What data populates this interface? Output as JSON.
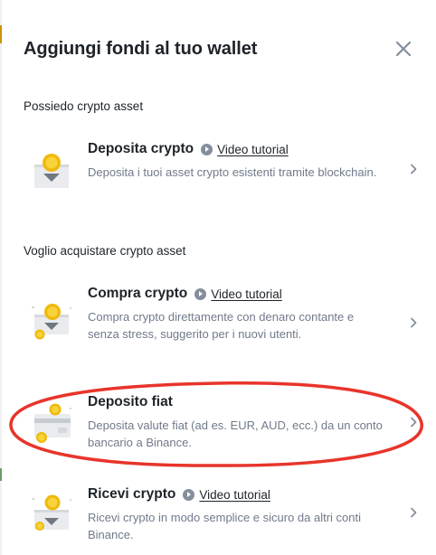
{
  "modal": {
    "title": "Aggiungi fondi al tuo wallet",
    "close_icon": "close-icon"
  },
  "sections": [
    {
      "label": "Possiedo crypto asset",
      "items": [
        {
          "name": "Deposita crypto",
          "tutorial": "Video tutorial",
          "description": "Deposita i tuoi asset crypto esistenti tramite blockchain.",
          "icon": "crypto-deposit-icon"
        }
      ]
    },
    {
      "label": "Voglio acquistare crypto asset",
      "items": [
        {
          "name": "Compra crypto",
          "tutorial": "Video tutorial",
          "description": "Compra crypto direttamente con denaro contante e senza stress, suggerito per i nuovi utenti.",
          "icon": "buy-crypto-icon"
        },
        {
          "name": "Deposito fiat",
          "description": "Deposita valute fiat (ad es. EUR, AUD, ecc.) da un conto bancario a Binance.",
          "icon": "fiat-deposit-icon"
        },
        {
          "name": "Ricevi crypto",
          "tutorial": "Video tutorial",
          "description": "Ricevi crypto in modo semplice e sicuro da altri conti Binance.",
          "icon": "receive-crypto-icon"
        }
      ]
    }
  ],
  "colors": {
    "accent": "#f0b90b",
    "highlight": "#e8342a",
    "muted": "#707a8a"
  }
}
